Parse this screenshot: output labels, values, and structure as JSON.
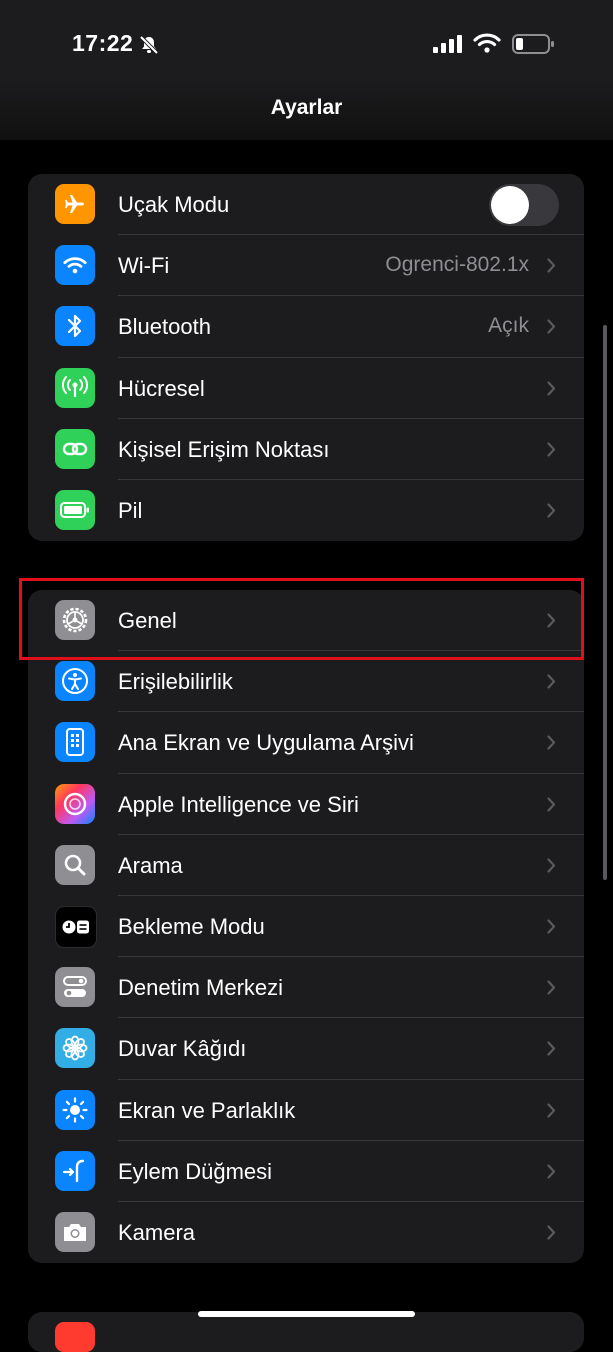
{
  "status_bar": {
    "time": "17:22"
  },
  "header": {
    "title": "Ayarlar"
  },
  "group1": [
    {
      "label": "Uçak Modu",
      "toggle": "off",
      "icon": "airplane-icon",
      "color": "#ff9500"
    },
    {
      "label": "Wi-Fi",
      "value": "Ogrenci-802.1x",
      "icon": "wifi-icon",
      "color": "#0a84ff"
    },
    {
      "label": "Bluetooth",
      "value": "Açık",
      "icon": "bluetooth-icon",
      "color": "#0a84ff"
    },
    {
      "label": "Hücresel",
      "icon": "antenna-icon",
      "color": "#30d158"
    },
    {
      "label": "Kişisel Erişim Noktası",
      "icon": "link-icon",
      "color": "#30d158"
    },
    {
      "label": "Pil",
      "icon": "battery-icon",
      "color": "#30d158"
    }
  ],
  "group2": [
    {
      "label": "Genel",
      "icon": "gear-icon",
      "color": "#8e8e93",
      "highlighted": true
    },
    {
      "label": "Erişilebilirlik",
      "icon": "accessibility-icon",
      "color": "#0a84ff"
    },
    {
      "label": "Ana Ekran ve Uygulama Arşivi",
      "icon": "phone-grid-icon",
      "color": "#0a84ff"
    },
    {
      "label": "Apple Intelligence ve Siri",
      "icon": "siri-icon",
      "color": "#bf5af2"
    },
    {
      "label": "Arama",
      "icon": "search-icon",
      "color": "#8e8e93"
    },
    {
      "label": "Bekleme Modu",
      "icon": "standby-icon",
      "color": "#000000"
    },
    {
      "label": "Denetim Merkezi",
      "icon": "sliders-icon",
      "color": "#8e8e93"
    },
    {
      "label": "Duvar Kâğıdı",
      "icon": "flower-icon",
      "color": "#32ade6"
    },
    {
      "label": "Ekran ve Parlaklık",
      "icon": "sun-icon",
      "color": "#0a84ff"
    },
    {
      "label": "Eylem Düğmesi",
      "icon": "action-button-icon",
      "color": "#0a84ff"
    },
    {
      "label": "Kamera",
      "icon": "camera-icon",
      "color": "#8e8e93"
    }
  ]
}
